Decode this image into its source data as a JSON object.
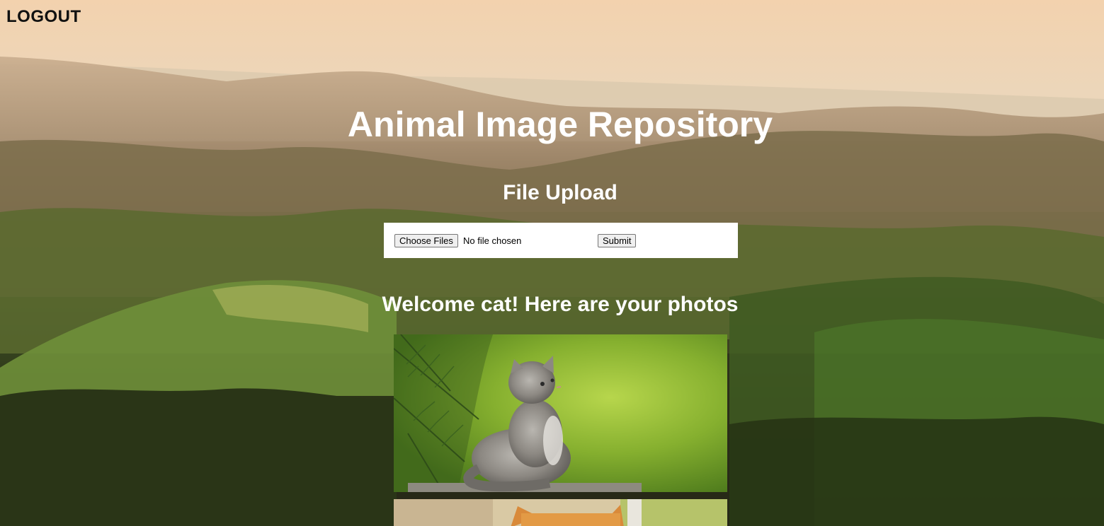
{
  "nav": {
    "logout_label": "LOGOUT"
  },
  "header": {
    "title": "Animal Image Repository"
  },
  "upload": {
    "title": "File Upload",
    "choose_label": "Choose Files",
    "file_status": "No file chosen",
    "submit_label": "Submit"
  },
  "gallery": {
    "welcome": "Welcome cat! Here are your photos",
    "photos": [
      {
        "subject": "grey kitten sitting among pine branches"
      },
      {
        "subject": "orange cat"
      }
    ]
  },
  "colors": {
    "heading_text": "#ffffff",
    "logout_text": "#111111",
    "upload_box": "#ffffff"
  }
}
